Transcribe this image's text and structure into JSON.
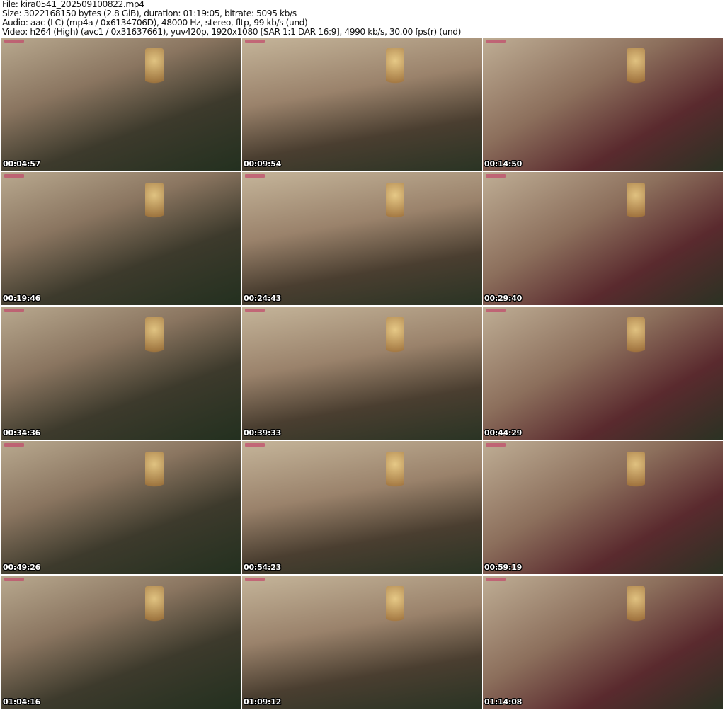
{
  "header": {
    "file": "File: kira0541_202509100822.mp4",
    "size": "Size: 3022168150 bytes (2.8 GiB), duration: 01:19:05, bitrate: 5095 kb/s",
    "audio": "Audio: aac (LC) (mp4a / 0x6134706D), 48000 Hz, stereo, fltp, 99 kb/s (und)",
    "video": "Video: h264 (High) (avc1 / 0x31637661), yuv420p, 1920x1080 [SAR 1:1 DAR 16:9], 4990 kb/s, 30.00 fps(r) (und)"
  },
  "thumbnails": [
    {
      "timestamp": "00:04:57"
    },
    {
      "timestamp": "00:09:54"
    },
    {
      "timestamp": "00:14:50"
    },
    {
      "timestamp": "00:19:46"
    },
    {
      "timestamp": "00:24:43"
    },
    {
      "timestamp": "00:29:40"
    },
    {
      "timestamp": "00:34:36"
    },
    {
      "timestamp": "00:39:33"
    },
    {
      "timestamp": "00:44:29"
    },
    {
      "timestamp": "00:49:26"
    },
    {
      "timestamp": "00:54:23"
    },
    {
      "timestamp": "00:59:19"
    },
    {
      "timestamp": "01:04:16"
    },
    {
      "timestamp": "01:09:12"
    },
    {
      "timestamp": "01:14:08"
    }
  ]
}
